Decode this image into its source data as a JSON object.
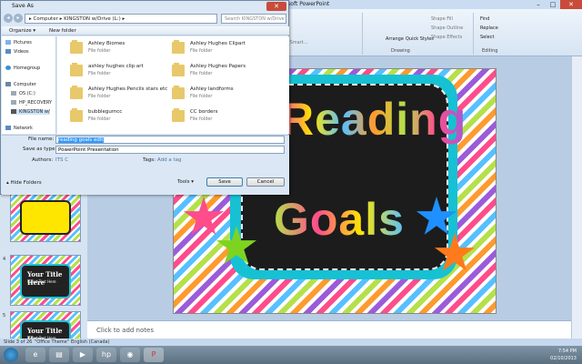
{
  "powerpoint": {
    "title": "Microsoft PowerPoint",
    "window_controls": [
      "–",
      "□",
      "✕"
    ],
    "ribbon": {
      "items": [
        "Shape Fill",
        "Shape Outline",
        "Shape Effects",
        "Find",
        "Replace",
        "Select",
        "Arrange",
        "Quick Styles"
      ],
      "frag_to": "to Smart...",
      "groups": [
        "Drawing",
        "Editing"
      ]
    },
    "slide": {
      "line1": "Reading",
      "line2": "Goals"
    },
    "thumbnails": [
      {
        "number": "",
        "title": "",
        "sub": ""
      },
      {
        "number": "4",
        "title": "Your Title Here",
        "sub": "Insert Text Here"
      },
      {
        "number": "5",
        "title": "Your Title Here",
        "sub": "Insert Text Here"
      }
    ],
    "notes_placeholder": "Click to add notes",
    "status": {
      "slide": "Slide 3 of 26",
      "theme": "\"Office Theme\"",
      "language": "English (Canada)"
    }
  },
  "taskbar": {
    "time": "7:54 PM",
    "date": "02/10/2013"
  },
  "dialog": {
    "title": "Save As",
    "close": "✕",
    "breadcrumb": "▸ Computer ▸ KINGSTON w/Drive (L:) ▸",
    "search_placeholder": "Search KINGSTON w/Drive (L:)",
    "toolbar": {
      "organize": "Organize ▾",
      "new_folder": "New folder"
    },
    "nav_items": [
      "Pictures",
      "Videos",
      "Homegroup",
      "Computer",
      "OS (C:)",
      "HP_RECOVERY",
      "KINGSTON w/",
      "Network"
    ],
    "files": [
      {
        "name": "Ashley Biomes",
        "desc": "File folder"
      },
      {
        "name": "Ashley Hughes Clipart",
        "desc": "File folder"
      },
      {
        "name": "ashley hughes clip art",
        "desc": "File folder"
      },
      {
        "name": "Ashley Hughes Papers",
        "desc": "File folder"
      },
      {
        "name": "Ashley Hughes Pencils stars etc",
        "desc": "File folder"
      },
      {
        "name": "Ashley landforms",
        "desc": "File folder"
      },
      {
        "name": "bubblegumcc",
        "desc": "File folder"
      },
      {
        "name": "CC borders",
        "desc": "File folder"
      }
    ],
    "form": {
      "file_name_label": "File name:",
      "file_name_value": "reading goals edit",
      "save_type_label": "Save as type:",
      "save_type_value": "PowerPoint Presentation",
      "authors_label": "Authors:",
      "authors_value": "ITS C",
      "tags_label": "Tags:",
      "tags_value": "Add a tag"
    },
    "hide_folders": "Hide Folders",
    "tools": "Tools ▾",
    "save": "Save",
    "cancel": "Cancel"
  }
}
